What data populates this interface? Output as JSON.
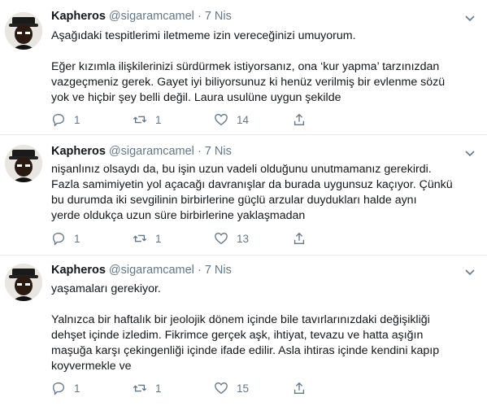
{
  "tweets": [
    {
      "name": "Kapheros",
      "handle": "@sigaramcamel",
      "separator": "·",
      "time": "7 Nis",
      "lines": [
        "Aşağıdaki tespitlerimi iletmeme izin vereceğinizi umuyorum.",
        "",
        "Eğer kızımla ilişkilerinizi sürdürmek istiyorsanız, ona ‘kur yapma’ tarzınızdan",
        "vazgeçmeniz gerek. Gayet iyi biliyorsunuz ki henüz verilmiş bir evlenme sözü",
        "yok ve hiçbir şey belli değil. Laura usulüne uygun şekilde"
      ],
      "replies": "1",
      "retweets": "1",
      "likes": "14"
    },
    {
      "name": "Kapheros",
      "handle": "@sigaramcamel",
      "separator": "·",
      "time": "7 Nis",
      "lines": [
        "nişanlınız olsaydı da, bu işin uzun vadeli olduğunu unutmamanız gerekirdi.",
        "Fazla samimiyetin yol açacağı davranışlar da burada uygunsuz kaçıyor. Çünkü",
        "bu durumda iki sevgilinin birbirlerine güçlü arzular duydukları halde aynı",
        "yerde oldukça uzun süre birbirlerine yaklaşmadan"
      ],
      "replies": "1",
      "retweets": "1",
      "likes": "13"
    },
    {
      "name": "Kapheros",
      "handle": "@sigaramcamel",
      "separator": "·",
      "time": "7 Nis",
      "lines": [
        "yaşamaları gerekiyor.",
        "",
        "Yalnızca bir haftalık bir jeolojik dönem içinde bile tavırlarınızdaki değişikliği",
        "dehşet içinde izledim. Fikrimce gerçek aşk, ihtiyat, tevazu ve hatta aşığın",
        "maşuğa karşı çekingenliği içinde ifade edilir. Asla ihtiras içinde kendini kapıp",
        "koyvermekle ve"
      ],
      "replies": "1",
      "retweets": "1",
      "likes": "15"
    }
  ],
  "colors": {
    "text": "#14171a",
    "muted": "#657786",
    "divider": "#e6ecf0"
  },
  "icons": [
    "avatar",
    "chevron-down-icon",
    "reply-icon",
    "retweet-icon",
    "like-icon",
    "share-icon"
  ]
}
